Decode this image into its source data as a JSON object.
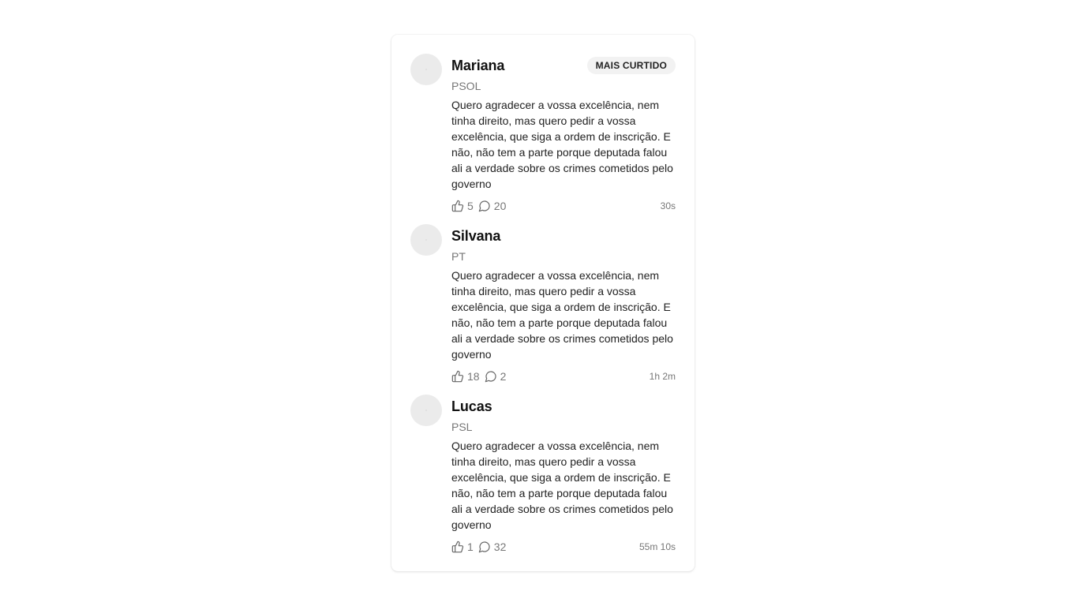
{
  "comments": [
    {
      "name": "Mariana",
      "party": "PSOL",
      "badge": "MAIS CURTIDO",
      "text": "Quero agradecer a vossa excelência, nem tinha direito, mas quero pedir a vossa excelência, que siga a ordem de inscrição. E não, não tem a parte porque deputada falou ali a verdade sobre os crimes cometidos pelo governo",
      "likes": "5",
      "replies": "20",
      "time": "30s"
    },
    {
      "name": "Silvana",
      "party": "PT",
      "badge": "",
      "text": "Quero agradecer a vossa excelência, nem tinha direito, mas quero pedir a vossa excelência, que siga a ordem de inscrição. E não, não tem a parte porque deputada falou ali a verdade sobre os crimes cometidos pelo governo",
      "likes": "18",
      "replies": "2",
      "time": "1h 2m"
    },
    {
      "name": "Lucas",
      "party": "PSL",
      "badge": "",
      "text": "Quero agradecer a vossa excelência, nem tinha direito, mas quero pedir a vossa excelência, que siga a ordem de inscrição. E não, não tem a parte porque deputada falou ali a verdade sobre os crimes cometidos pelo governo",
      "likes": "1",
      "replies": "32",
      "time": "55m 10s"
    }
  ],
  "icons": {
    "like": "thumbs-up-icon",
    "reply": "speech-bubble-icon"
  },
  "colors": {
    "badge_bg": "#f2f2f2",
    "muted_text": "#777777",
    "avatar": "#ebebeb"
  }
}
